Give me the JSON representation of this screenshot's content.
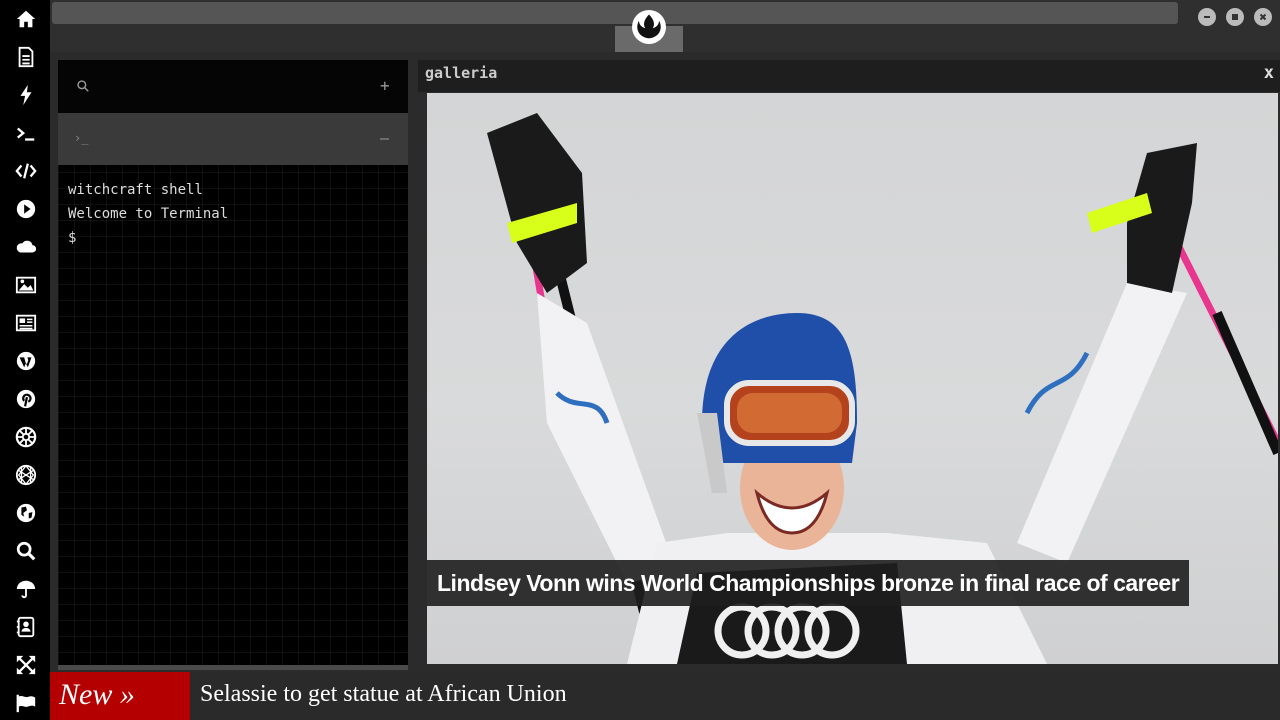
{
  "sidebar": {
    "items": [
      {
        "icon": "home-icon"
      },
      {
        "icon": "document-icon"
      },
      {
        "icon": "lightning-icon"
      },
      {
        "icon": "terminal-icon"
      },
      {
        "icon": "code-icon"
      },
      {
        "icon": "play-icon"
      },
      {
        "icon": "cloud-icon"
      },
      {
        "icon": "image-icon"
      },
      {
        "icon": "newspaper-icon"
      },
      {
        "icon": "wordpress-icon"
      },
      {
        "icon": "pinterest-icon"
      },
      {
        "icon": "empire-icon"
      },
      {
        "icon": "globe-mesh-icon"
      },
      {
        "icon": "globe-icon"
      },
      {
        "icon": "search-icon"
      },
      {
        "icon": "umbrella-icon"
      },
      {
        "icon": "contacts-icon"
      },
      {
        "icon": "expand-icon"
      },
      {
        "icon": "flag-icon"
      }
    ]
  },
  "window_controls": {
    "minimize": "minimize-icon",
    "maximize": "maximize-icon",
    "close": "close-icon"
  },
  "logo": {
    "icon": "rebel-alliance-icon"
  },
  "terminal": {
    "search_icon": "search-icon",
    "add_symbol": "+",
    "prompt_symbol": "›_",
    "collapse_symbol": "–",
    "lines": [
      "witchcraft shell",
      "Welcome to Terminal",
      "$"
    ]
  },
  "galleria": {
    "title": "galleria",
    "close_symbol": "x",
    "caption": "Lindsey Vonn wins World Championships bronze in final race of career"
  },
  "ticker": {
    "label": "New »",
    "headline": "Selassie to get statue at African Union"
  },
  "colors": {
    "sidebar": "#000000",
    "ticker_label_bg": "#b40000",
    "background": "#2b2b2b"
  }
}
